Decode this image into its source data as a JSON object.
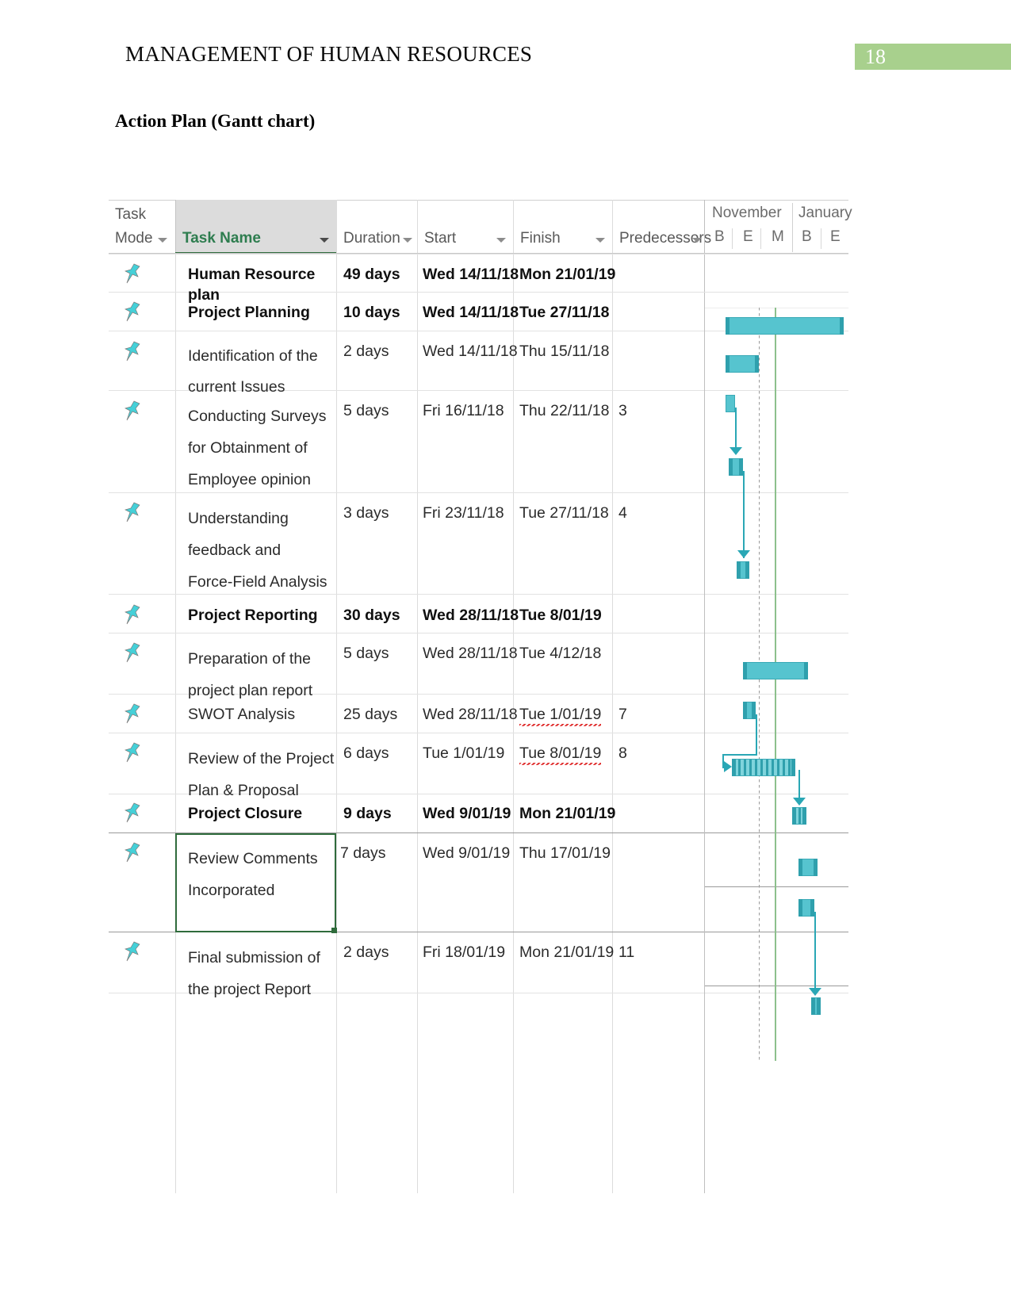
{
  "header": {
    "running_title": "MANAGEMENT OF HUMAN RESOURCES",
    "page_number": "18",
    "badge_color": "#a8d08d"
  },
  "section": {
    "title": "Action Plan (Gantt chart)"
  },
  "gantt": {
    "columns": [
      {
        "key": "task_mode",
        "line1": "Task",
        "line2": "Mode",
        "has_caret": true,
        "selected": false
      },
      {
        "key": "task_name",
        "line1": "",
        "line2": "Task Name",
        "has_caret": true,
        "selected": true
      },
      {
        "key": "duration",
        "line1": "",
        "line2": "Duration",
        "has_caret": true,
        "selected": false
      },
      {
        "key": "start",
        "line1": "",
        "line2": "Start",
        "has_caret": true,
        "selected": false
      },
      {
        "key": "finish",
        "line1": "",
        "line2": "Finish",
        "has_caret": true,
        "selected": false
      },
      {
        "key": "predecessors",
        "line1": "",
        "line2": "Predecessors",
        "has_caret": true,
        "selected": false
      }
    ],
    "timeline": {
      "months": [
        "November",
        "January"
      ],
      "ticks": [
        "B",
        "E",
        "M",
        "B",
        "E"
      ]
    },
    "accent_color": "#56c4cf",
    "selected_cell_border": "#2f6b3c",
    "task_mode_icon": "pushpin-icon",
    "rows": [
      {
        "id": 1,
        "mode_icon": "pushpin-icon",
        "name": "Human  Resource plan",
        "duration": "49 days",
        "start": "Wed 14/11/18",
        "finish": "Mon 21/01/19",
        "predecessors": "",
        "bold": true,
        "finish_flagged": false,
        "selected": false
      },
      {
        "id": 2,
        "mode_icon": "pushpin-icon",
        "name": "Project Planning",
        "duration": "10 days",
        "start": "Wed 14/11/18",
        "finish": "Tue 27/11/18",
        "predecessors": "",
        "bold": true,
        "finish_flagged": false,
        "selected": false
      },
      {
        "id": 3,
        "mode_icon": "pushpin-icon",
        "name": "Identification of the\ncurrent Issues",
        "duration": "2 days",
        "start": "Wed 14/11/18",
        "finish": "Thu 15/11/18",
        "predecessors": "",
        "bold": false,
        "finish_flagged": false,
        "selected": false
      },
      {
        "id": 4,
        "mode_icon": "pushpin-icon",
        "name": "Conducting Surveys\nfor Obtainment of\nEmployee opinion",
        "duration": "5 days",
        "start": "Fri 16/11/18",
        "finish": "Thu 22/11/18",
        "predecessors": "3",
        "bold": false,
        "finish_flagged": false,
        "selected": false
      },
      {
        "id": 5,
        "mode_icon": "pushpin-icon",
        "name": "Understanding\nfeedback and\nForce-Field Analysis",
        "duration": "3 days",
        "start": "Fri 23/11/18",
        "finish": "Tue 27/11/18",
        "predecessors": "4",
        "bold": false,
        "finish_flagged": false,
        "selected": false
      },
      {
        "id": 6,
        "mode_icon": "pushpin-icon",
        "name": "Project Reporting",
        "duration": "30 days",
        "start": "Wed 28/11/18",
        "finish": "Tue 8/01/19",
        "predecessors": "",
        "bold": true,
        "finish_flagged": false,
        "selected": false
      },
      {
        "id": 7,
        "mode_icon": "pushpin-icon",
        "name": "Preparation of the\nproject plan report",
        "duration": "5 days",
        "start": "Wed 28/11/18",
        "finish": "Tue 4/12/18",
        "predecessors": "",
        "bold": false,
        "finish_flagged": false,
        "selected": false
      },
      {
        "id": 8,
        "mode_icon": "pushpin-icon",
        "name": "SWOT Analysis",
        "duration": "25 days",
        "start": "Wed 28/11/18",
        "finish": "Tue 1/01/19",
        "predecessors": "7",
        "bold": false,
        "finish_flagged": true,
        "selected": false
      },
      {
        "id": 9,
        "mode_icon": "pushpin-icon",
        "name": "Review of the Project\nPlan & Proposal",
        "duration": "6 days",
        "start": "Tue 1/01/19",
        "finish": "Tue 8/01/19",
        "predecessors": "8",
        "bold": false,
        "finish_flagged": true,
        "selected": false
      },
      {
        "id": 10,
        "mode_icon": "pushpin-icon",
        "name": "Project Closure",
        "duration": "9 days",
        "start": "Wed 9/01/19",
        "finish": "Mon 21/01/19",
        "predecessors": "",
        "bold": true,
        "finish_flagged": false,
        "selected": false
      },
      {
        "id": 11,
        "mode_icon": "pushpin-icon",
        "name": "Review Comments\nIncorporated",
        "duration": "7 days",
        "start": "Wed 9/01/19",
        "finish": "Thu 17/01/19",
        "predecessors": "",
        "bold": false,
        "finish_flagged": false,
        "selected": true
      },
      {
        "id": 12,
        "mode_icon": "pushpin-icon",
        "name": "Final submission of\nthe project Report",
        "duration": "2 days",
        "start": "Fri 18/01/19",
        "finish": "Mon 21/01/19",
        "predecessors": "11",
        "bold": false,
        "finish_flagged": false,
        "selected": false
      }
    ]
  },
  "chart_data": {
    "type": "bar",
    "title": "Action Plan (Gantt chart)",
    "xlabel": "",
    "ylabel": "",
    "orientation": "horizontal-timeline",
    "x_axis": {
      "months": [
        "November",
        "January"
      ],
      "tick_labels": [
        "B",
        "E",
        "M",
        "B",
        "E"
      ],
      "range_start": "2018-11-14",
      "range_end": "2019-01-21"
    },
    "grid": true,
    "legend": null,
    "categories": [
      "Human  Resource plan",
      "Project Planning",
      "Identification of the current Issues",
      "Conducting Surveys for Obtainment of Employee opinion",
      "Understanding feedback and Force-Field Analysis",
      "Project Reporting",
      "Preparation of the project plan report",
      "SWOT Analysis",
      "Review of the Project Plan & Proposal",
      "Project Closure",
      "Review Comments Incorporated",
      "Final submission of the project Report"
    ],
    "values": [
      49,
      10,
      2,
      5,
      3,
      30,
      5,
      25,
      6,
      9,
      7,
      2
    ],
    "units": "days",
    "bars": [
      {
        "task": "Human  Resource plan",
        "start": "Wed 14/11/18",
        "finish": "Mon 21/01/19",
        "duration_days": 49,
        "style": "summary",
        "x_pct": 0.0,
        "w_pct": 100.0
      },
      {
        "task": "Project Planning",
        "start": "Wed 14/11/18",
        "finish": "Tue 27/11/18",
        "duration_days": 10,
        "style": "summary",
        "x_pct": 0.0,
        "w_pct": 20.4
      },
      {
        "task": "Identification of the current Issues",
        "start": "Wed 14/11/18",
        "finish": "Thu 15/11/18",
        "duration_days": 2,
        "style": "task",
        "x_pct": 0.0,
        "w_pct": 4.1
      },
      {
        "task": "Conducting Surveys for Obtainment of Employee opinion",
        "start": "Fri 16/11/18",
        "finish": "Thu 22/11/18",
        "duration_days": 5,
        "style": "task",
        "x_pct": 4.1,
        "w_pct": 10.2
      },
      {
        "task": "Understanding feedback and Force-Field Analysis",
        "start": "Fri 23/11/18",
        "finish": "Tue 27/11/18",
        "duration_days": 3,
        "style": "task",
        "x_pct": 14.3,
        "w_pct": 6.1
      },
      {
        "task": "Project Reporting",
        "start": "Wed 28/11/18",
        "finish": "Tue 8/01/19",
        "duration_days": 30,
        "style": "summary",
        "x_pct": 20.4,
        "w_pct": 61.2
      },
      {
        "task": "Preparation of the project plan report",
        "start": "Wed 28/11/18",
        "finish": "Tue 4/12/18",
        "duration_days": 5,
        "style": "task",
        "x_pct": 20.4,
        "w_pct": 10.2
      },
      {
        "task": "SWOT Analysis",
        "start": "Wed 28/11/18",
        "finish": "Tue 1/01/19",
        "duration_days": 25,
        "style": "hatched",
        "x_pct": 20.4,
        "w_pct": 51.0
      },
      {
        "task": "Review of the Project Plan & Proposal",
        "start": "Tue 1/01/19",
        "finish": "Tue 8/01/19",
        "duration_days": 6,
        "style": "hatched",
        "x_pct": 71.4,
        "w_pct": 12.2
      },
      {
        "task": "Project Closure",
        "start": "Wed 9/01/19",
        "finish": "Mon 21/01/19",
        "duration_days": 9,
        "style": "summary",
        "x_pct": 81.6,
        "w_pct": 18.4
      },
      {
        "task": "Review Comments Incorporated",
        "start": "Wed 9/01/19",
        "finish": "Thu 17/01/19",
        "duration_days": 7,
        "style": "task",
        "x_pct": 81.6,
        "w_pct": 14.3
      },
      {
        "task": "Final submission of the project Report",
        "start": "Fri 18/01/19",
        "finish": "Mon 21/01/19",
        "duration_days": 2,
        "style": "task",
        "x_pct": 95.9,
        "w_pct": 4.1
      }
    ],
    "dependencies": [
      {
        "from": "Identification of the current Issues",
        "to": "Conducting Surveys for Obtainment of Employee opinion"
      },
      {
        "from": "Conducting Surveys for Obtainment of Employee opinion",
        "to": "Understanding feedback and Force-Field Analysis"
      },
      {
        "from": "Preparation of the project plan report",
        "to": "SWOT Analysis"
      },
      {
        "from": "SWOT Analysis",
        "to": "Review of the Project Plan & Proposal"
      },
      {
        "from": "Review Comments Incorporated",
        "to": "Final submission of the project Report"
      }
    ]
  }
}
